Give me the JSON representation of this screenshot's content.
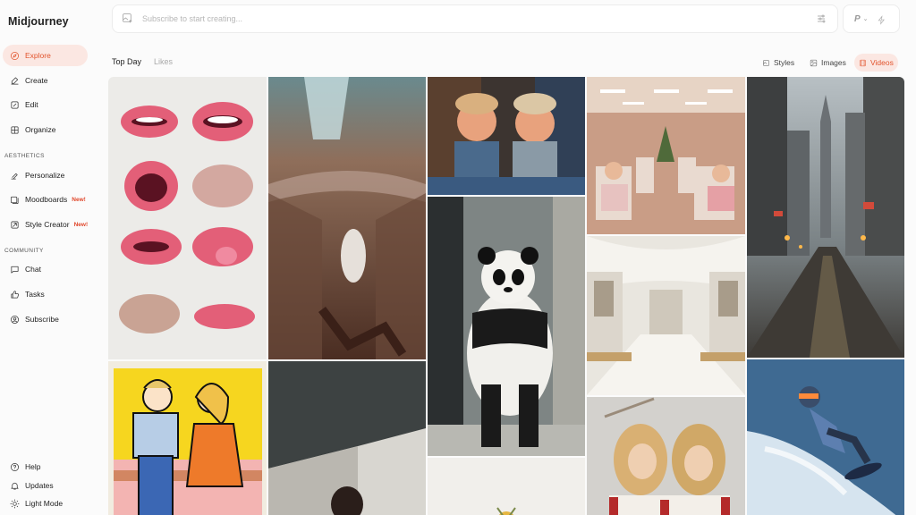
{
  "app": {
    "title": "Midjourney"
  },
  "sidebar": {
    "items": [
      {
        "label": "Explore",
        "icon": "compass-icon"
      },
      {
        "label": "Create",
        "icon": "create-icon"
      },
      {
        "label": "Edit",
        "icon": "edit-icon"
      },
      {
        "label": "Organize",
        "icon": "grid-icon"
      }
    ],
    "aesthetics_label": "AESTHETICS",
    "aesthetics": [
      {
        "label": "Personalize",
        "icon": "personalize-icon"
      },
      {
        "label": "Moodboards",
        "icon": "moodboard-icon",
        "badge": "New!"
      },
      {
        "label": "Style Creator",
        "icon": "style-creator-icon",
        "badge": "New!"
      }
    ],
    "community_label": "COMMUNITY",
    "community": [
      {
        "label": "Chat",
        "icon": "chat-icon"
      },
      {
        "label": "Tasks",
        "icon": "thumbs-up-icon"
      },
      {
        "label": "Subscribe",
        "icon": "user-circle-icon"
      }
    ],
    "bottom": [
      {
        "label": "Help",
        "icon": "help-icon"
      },
      {
        "label": "Updates",
        "icon": "bell-icon"
      },
      {
        "label": "Light Mode",
        "icon": "sun-icon"
      }
    ]
  },
  "search": {
    "placeholder": "Subscribe to start creating..."
  },
  "mode": {
    "label": "P",
    "chevron": "⌄"
  },
  "filters": {
    "top_day": "Top Day",
    "likes": "Likes"
  },
  "views": {
    "styles": "Styles",
    "images": "Images",
    "videos": "Videos"
  },
  "colors": {
    "accent": "#e2552e",
    "accent_bg": "#fbe7e2"
  }
}
